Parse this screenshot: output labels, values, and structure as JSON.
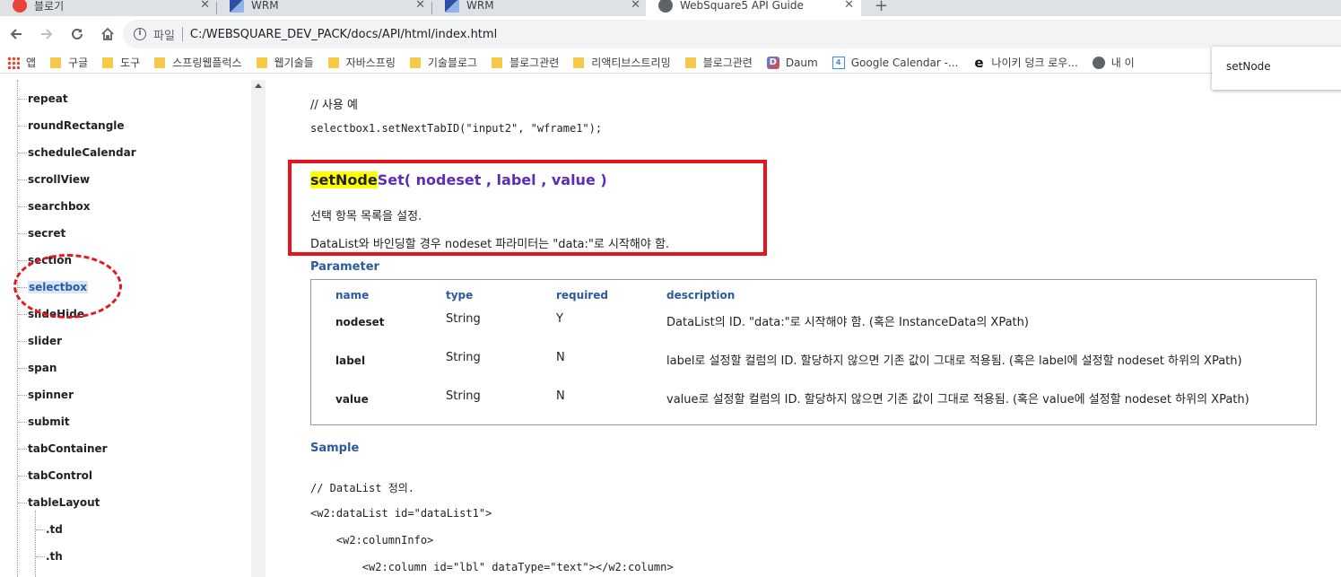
{
  "tabs": [
    {
      "title": "블로기",
      "icon": "warning-icon"
    },
    {
      "title": "WRM",
      "icon": "wrm-icon"
    },
    {
      "title": "WRM",
      "icon": "wrm-icon"
    },
    {
      "title": "WebSquare5 API Guide",
      "icon": "globe-icon"
    }
  ],
  "omnibox": {
    "scheme_label": "파일",
    "url": "C:/WEBSQUARE_DEV_PACK/docs/API/html/index.html"
  },
  "bookmarks": [
    {
      "label": "앱",
      "icon": "apps-icon"
    },
    {
      "label": "구글",
      "icon": "folder-icon"
    },
    {
      "label": "도구",
      "icon": "folder-icon"
    },
    {
      "label": "스프링웹플럭스",
      "icon": "folder-icon"
    },
    {
      "label": "웹기술들",
      "icon": "folder-icon"
    },
    {
      "label": "자바스프링",
      "icon": "folder-icon"
    },
    {
      "label": "기술블로그",
      "icon": "folder-icon"
    },
    {
      "label": "블로그관련",
      "icon": "folder-icon"
    },
    {
      "label": "리액티브스트리밍",
      "icon": "folder-icon"
    },
    {
      "label": "블로그관련",
      "icon": "folder-icon"
    },
    {
      "label": "Daum",
      "icon": "daum-icon"
    },
    {
      "label": "Google Calendar -...",
      "icon": "calendar-icon"
    },
    {
      "label": "나이키 덩크 로우...",
      "icon": "ie-icon"
    },
    {
      "label": "내 이",
      "icon": "globe-icon"
    }
  ],
  "find": {
    "text": "setNode"
  },
  "sidebar": {
    "items": [
      "repeat",
      "roundRectangle",
      "scheduleCalendar",
      "scrollView",
      "searchbox",
      "secret",
      "section",
      "selectbox",
      "slideHide",
      "slider",
      "span",
      "spinner",
      "submit",
      "tabContainer",
      "tabControl",
      "tableLayout"
    ],
    "selected": "selectbox",
    "sub_items": [
      ".td",
      ".th"
    ]
  },
  "content": {
    "example_comment": "// 사용 예",
    "example_code": "selectbox1.setNextTabID(\"input2\", \"wframe1\");",
    "method": {
      "highlight": "setNode",
      "rest": "Set( nodeset , label , value )",
      "desc1": "선택 항목 목록을 설정.",
      "desc2": "DataList와 바인딩할 경우 nodeset 파라미터는 \"data:\"로 시작해야 함."
    },
    "parameter_title": "Parameter",
    "param_headers": [
      "name",
      "type",
      "required",
      "description"
    ],
    "params": [
      {
        "name": "nodeset",
        "type": "String",
        "required": "Y",
        "description": "DataList의 ID. \"data:\"로 시작해야 함. (혹은 InstanceData의 XPath)"
      },
      {
        "name": "label",
        "type": "String",
        "required": "N",
        "description": "label로 설정할 컬럼의 ID. 할당하지 않으면 기존 값이 그대로 적용됨. (혹은 label에 설정할 nodeset 하위의 XPath)"
      },
      {
        "name": "value",
        "type": "String",
        "required": "N",
        "description": "value로 설정할 컬럼의 ID. 할당하지 않으면 기존 값이 그대로 적용됨. (혹은 value에 설정할 nodeset 하위의 XPath)"
      }
    ],
    "sample_title": "Sample",
    "sample_lines": [
      "// DataList 정의.",
      "<w2:dataList id=\"dataList1\">",
      "    <w2:columnInfo>",
      "        <w2:column id=\"lbl\" dataType=\"text\"></w2:column>"
    ]
  }
}
